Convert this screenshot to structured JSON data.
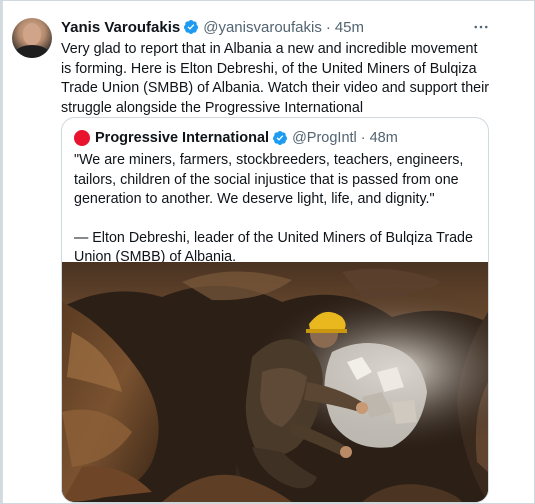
{
  "tweet": {
    "author_name": "Yanis Varoufakis",
    "author_handle": "@yanisvaroufakis",
    "separator": "·",
    "time": "45m",
    "more_icon": "more-horizontal-icon",
    "text": "Very glad to report that in Albania a new and incredible movement is forming. Here is Elton Debreshi, of the United Miners of Bulqiza Trade Union (SMBB) of Albania. Watch their video and support their struggle alongside the Progressive International"
  },
  "quote": {
    "author_name": "Progressive International",
    "author_handle": "@ProgIntl",
    "separator": "·",
    "time": "48m",
    "paragraph1": "\"We are miners, farmers, stockbreeders, teachers, engineers, tailors, children of the social injustice that is passed from one generation to another. We deserve light, life, and dignity.\"",
    "paragraph2": "— Elton Debreshi, leader of the United Miners of Bulqiza Trade Union (SMBB) of Albania."
  },
  "colors": {
    "verified_blue": "#1d9bf0",
    "quote_avatar_red": "#e8132f",
    "muted_text": "#536471",
    "border": "#cfd9de"
  }
}
